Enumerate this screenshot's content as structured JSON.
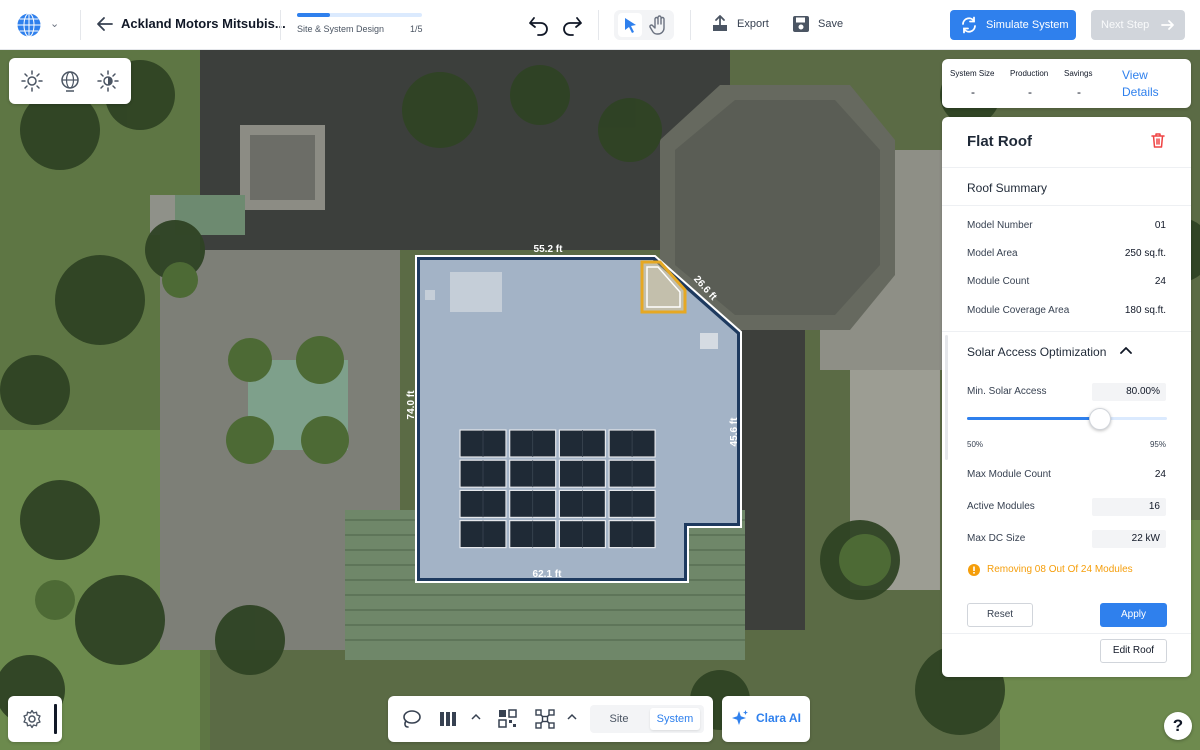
{
  "header": {
    "project_title": "Ackland Motors Mitsubis...",
    "progress": {
      "label": "Site & System Design",
      "step": "1/5",
      "fraction": 0.26
    },
    "export_label": "Export",
    "save_label": "Save",
    "simulate_label": "Simulate System",
    "next_label": "Next Step"
  },
  "summary": {
    "system_size_label": "System Size",
    "system_size_value": "-",
    "production_label": "Production",
    "production_value": "-",
    "savings_label": "Savings",
    "savings_value": "-",
    "view_details_label": "View Details"
  },
  "panel": {
    "title": "Flat Roof",
    "roof_summary_title": "Roof Summary",
    "rows": [
      {
        "label": "Model Number",
        "value": "01"
      },
      {
        "label": "Model Area",
        "value": "250 sq.ft."
      },
      {
        "label": "Module Count",
        "value": "24"
      },
      {
        "label": "Module Coverage Area",
        "value": "180 sq.ft."
      }
    ],
    "solar_access_title": "Solar Access Optimization",
    "min_solar_access_label": "Min. Solar Access",
    "min_solar_access_value": "80.00%",
    "slider": {
      "min_label": "50%",
      "max_label": "95%",
      "min": 50,
      "max": 95,
      "value": 80
    },
    "max_module_count_label": "Max Module Count",
    "max_module_count_value": "24",
    "active_modules_label": "Active Modules",
    "active_modules_value": "16",
    "max_dc_size_label": "Max DC Size",
    "max_dc_size_value": "22 kW",
    "warning_text": "Removing 08 Out Of 24 Modules",
    "reset_label": "Reset",
    "apply_label": "Apply",
    "edit_roof_label": "Edit Roof"
  },
  "map": {
    "dimensions": {
      "top": "55.2 ft",
      "diagonal": "26.6 ft",
      "left": "74.0 ft",
      "right": "45.6 ft",
      "bottom": "62.1 ft"
    },
    "panel_array": {
      "rows": 4,
      "columns": 4
    }
  },
  "bottom": {
    "site_tab": "Site",
    "system_tab": "System",
    "active_tab": "System",
    "clara_label": "Clara AI",
    "help_label": "?"
  },
  "colors": {
    "accent": "#2f80ed",
    "warning": "#f59e0b",
    "danger": "#ef4444",
    "roof_fill": "#9fb0c6"
  },
  "icons": {
    "logo": "globe-grid-icon",
    "back": "arrow-left-icon",
    "undo": "undo-icon",
    "redo": "redo-icon",
    "select": "cursor-icon",
    "pan": "hand-icon",
    "export": "export-icon",
    "save": "floppy-icon",
    "simulate": "refresh-icon",
    "next": "arrow-right-icon",
    "sun": "sun-icon",
    "globe": "globe-icon",
    "shade": "shade-sun-icon",
    "delete": "trash-icon",
    "collapse": "chevron-up-icon",
    "warning": "warning-circle-icon",
    "settings": "gear-icon",
    "lasso": "lasso-icon",
    "columns": "columns-icon",
    "qr": "qr-grid-icon",
    "network": "network-icon",
    "sparkle": "sparkle-icon",
    "help": "help-icon"
  }
}
